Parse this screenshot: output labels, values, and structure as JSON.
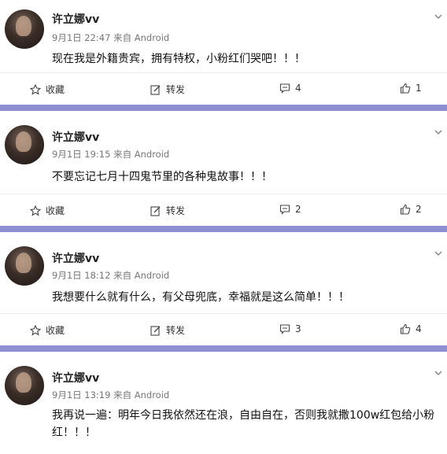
{
  "posts": [
    {
      "username": "许立娜vv",
      "time": "9月1日 22:47",
      "source": "来自 Android",
      "content": "现在我是外籍贵宾，拥有特权，小粉红们哭吧！！！",
      "actions": {
        "favorite": "收藏",
        "repost": "转发",
        "comments": "4",
        "likes": "1"
      }
    },
    {
      "username": "许立娜vv",
      "time": "9月1日 19:15",
      "source": "来自 Android",
      "content": "不要忘记七月十四鬼节里的各种鬼故事！！！",
      "actions": {
        "favorite": "收藏",
        "repost": "转发",
        "comments": "2",
        "likes": "2"
      }
    },
    {
      "username": "许立娜vv",
      "time": "9月1日 18:12",
      "source": "来自 Android",
      "content": "我想要什么就有什么，有父母兜底，幸福就是这么简单！！！",
      "actions": {
        "favorite": "收藏",
        "repost": "转发",
        "comments": "3",
        "likes": "4"
      }
    },
    {
      "username": "许立娜vv",
      "time": "9月1日 13:19",
      "source": "来自 Android",
      "content": "我再说一遍：明年今日我依然还在浪，自由自在，否则我就撒100w红包给小粉红！！！"
    }
  ],
  "colors": {
    "divider": "#8e8fd0"
  }
}
